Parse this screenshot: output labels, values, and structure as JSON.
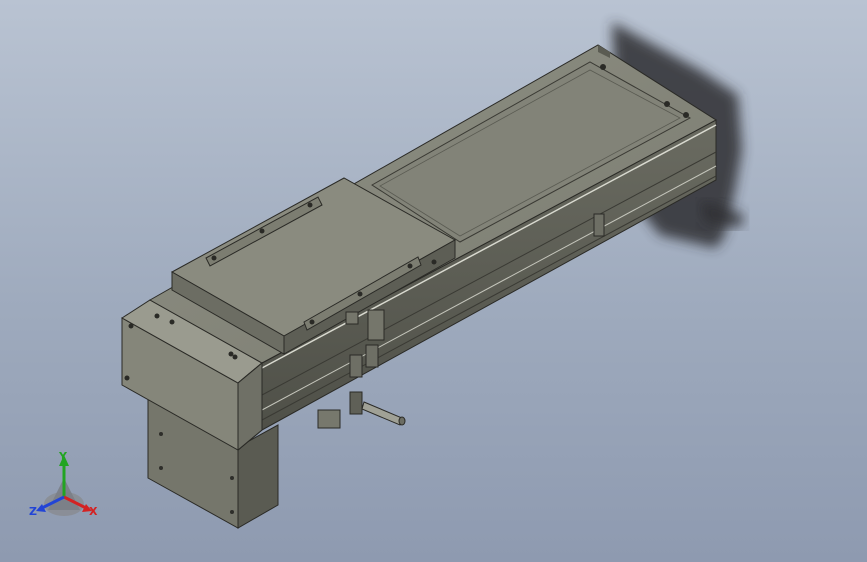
{
  "viewport": {
    "background_top": "#b9c3d2",
    "background_bottom": "#8e9ab0"
  },
  "model": {
    "name": "linear-actuator-module",
    "body_color": "#7b7c70",
    "body_dark": "#55564d",
    "body_light": "#9d9e92"
  },
  "triad": {
    "x_label": "X",
    "y_label": "Y",
    "z_label": "Z",
    "x_color": "#d42222",
    "y_color": "#22a422",
    "z_color": "#2244d6"
  }
}
